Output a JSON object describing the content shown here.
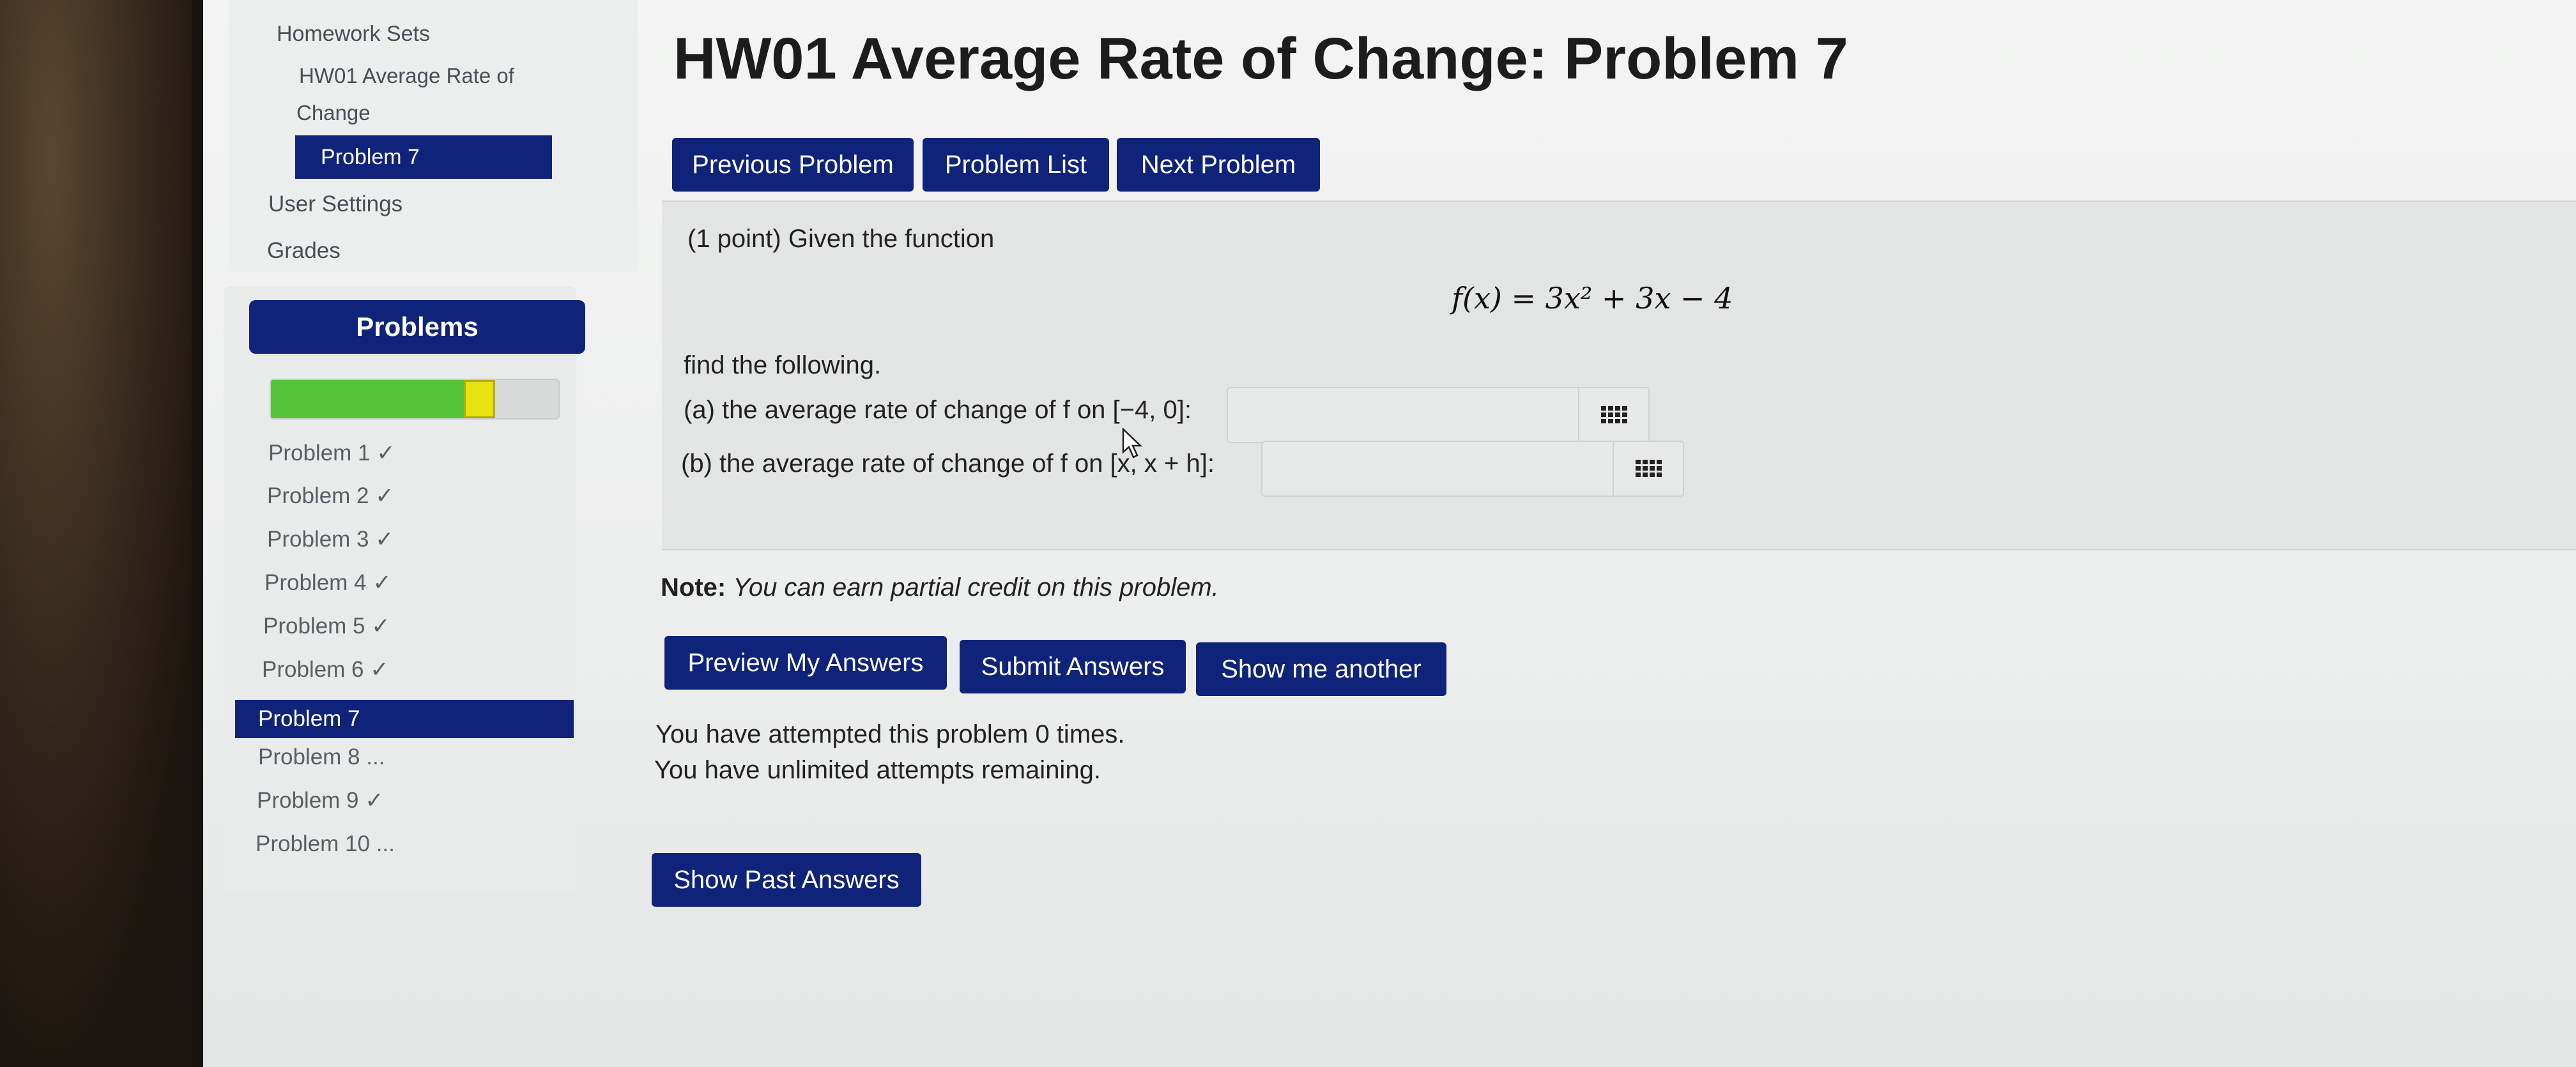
{
  "nav": {
    "homework_sets": "Homework Sets",
    "set_name_line1": "HW01 Average Rate of",
    "set_name_line2": "Change",
    "current_problem": "Problem 7",
    "user_settings": "User Settings",
    "grades": "Grades"
  },
  "problems_panel": {
    "header": "Problems",
    "progress": {
      "correct_fraction": 0.67,
      "partial_fraction": 0.11,
      "correct_color": "#55c43a",
      "partial_color": "#e9e110"
    },
    "items": [
      {
        "label": "Problem 1 ✓"
      },
      {
        "label": "Problem 2 ✓"
      },
      {
        "label": "Problem 3 ✓"
      },
      {
        "label": "Problem 4 ✓"
      },
      {
        "label": "Problem 5 ✓"
      },
      {
        "label": "Problem 6 ✓"
      },
      {
        "label": "Problem 7"
      },
      {
        "label": "Problem 8 ..."
      },
      {
        "label": "Problem 9 ✓"
      },
      {
        "label": "Problem 10 ..."
      }
    ]
  },
  "main": {
    "title": "HW01 Average Rate of Change: Problem 7",
    "nav_buttons": {
      "previous": "Previous Problem",
      "list": "Problem List",
      "next": "Next Problem"
    },
    "problem": {
      "intro": "(1 point) Given the function",
      "function": "f(x) = 3x² + 3x − 4",
      "find": "find the following.",
      "part_a": "(a) the average rate of change of f on [−4, 0]:",
      "part_b": "(b) the average rate of change of f on [x, x + h]:",
      "answer_a": "",
      "answer_b": ""
    },
    "note_label": "Note:",
    "note_text": "You can earn partial credit on this problem.",
    "action_buttons": {
      "preview": "Preview My Answers",
      "submit": "Submit Answers",
      "another": "Show me another"
    },
    "attempts_line1": "You have attempted this problem 0 times.",
    "attempts_line2": "You have unlimited attempts remaining.",
    "past_answers": "Show Past Answers"
  },
  "colors": {
    "primary": "#10237a",
    "panel_bg": "#e3e5e4"
  }
}
